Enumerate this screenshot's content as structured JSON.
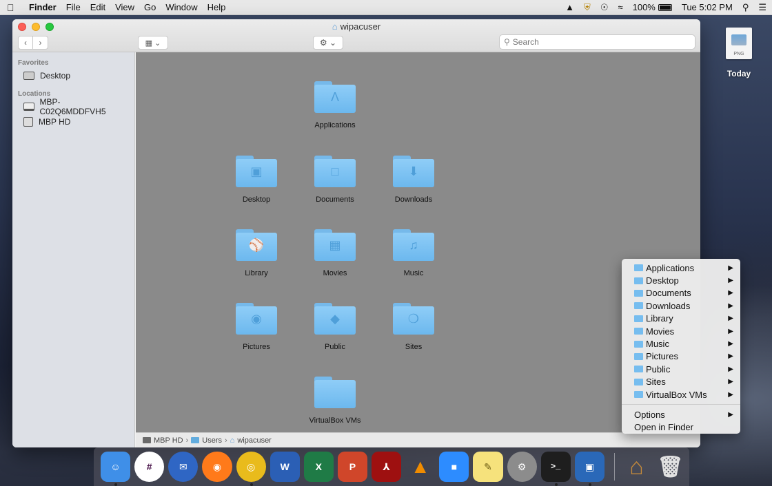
{
  "menubar": {
    "app": "Finder",
    "items": [
      "File",
      "Edit",
      "View",
      "Go",
      "Window",
      "Help"
    ],
    "battery": "100%",
    "clock": "Tue 5:02 PM"
  },
  "window": {
    "title": "wipacuser",
    "search_placeholder": "Search",
    "view_label": "▦",
    "sidebar": {
      "favorites_heading": "Favorites",
      "favorites": [
        {
          "label": "Desktop"
        }
      ],
      "locations_heading": "Locations",
      "locations": [
        {
          "label": "MBP-C02Q6MDDFVH5"
        },
        {
          "label": "MBP HD"
        }
      ]
    },
    "folders": [
      {
        "label": "Applications",
        "icon": "apps-icon"
      },
      {
        "label": "Desktop",
        "icon": "desktop-icon"
      },
      {
        "label": "Documents",
        "icon": "documents-icon"
      },
      {
        "label": "Downloads",
        "icon": "downloads-icon"
      },
      {
        "label": "Library",
        "icon": "library-icon"
      },
      {
        "label": "Movies",
        "icon": "movies-icon"
      },
      {
        "label": "Music",
        "icon": "music-icon"
      },
      {
        "label": "Pictures",
        "icon": "pictures-icon"
      },
      {
        "label": "Public",
        "icon": "public-icon"
      },
      {
        "label": "Sites",
        "icon": "sites-icon"
      },
      {
        "label": "VirtualBox VMs",
        "icon": "folder-icon"
      }
    ],
    "pathbar": [
      "MBP HD",
      "Users",
      "wipacuser"
    ]
  },
  "desktop_item": {
    "label": "Today",
    "ext": "PNG"
  },
  "context_menu": {
    "folders": [
      "Applications",
      "Desktop",
      "Documents",
      "Downloads",
      "Library",
      "Movies",
      "Music",
      "Pictures",
      "Public",
      "Sites",
      "VirtualBox VMs"
    ],
    "options": "Options",
    "open_in_finder": "Open in Finder"
  },
  "dock": [
    {
      "name": "finder",
      "color": "#3f8fe8",
      "glyph": "☺"
    },
    {
      "name": "slack",
      "color": "#ffffff",
      "glyph": "#"
    },
    {
      "name": "thunderbird",
      "color": "#2f66c4",
      "glyph": "✉"
    },
    {
      "name": "firefox",
      "color": "#ff7a1a",
      "glyph": "◉"
    },
    {
      "name": "chrome",
      "color": "#e9bb1c",
      "glyph": "◎"
    },
    {
      "name": "word",
      "color": "#2b5fb5",
      "glyph": "W"
    },
    {
      "name": "excel",
      "color": "#1f7b46",
      "glyph": "X"
    },
    {
      "name": "powerpoint",
      "color": "#d0462a",
      "glyph": "P"
    },
    {
      "name": "acrobat",
      "color": "#9e1010",
      "glyph": "⅄"
    },
    {
      "name": "vlc",
      "color": "#f08c00",
      "glyph": "▲"
    },
    {
      "name": "zoom",
      "color": "#2d8cff",
      "glyph": "■"
    },
    {
      "name": "stickies",
      "color": "#f6e27c",
      "glyph": "✎"
    },
    {
      "name": "system-preferences",
      "color": "#8c8c8c",
      "glyph": "⚙"
    },
    {
      "name": "terminal",
      "color": "#1e1e1e",
      "glyph": ">_"
    },
    {
      "name": "virtualbox",
      "color": "#2a68b8",
      "glyph": "▣"
    }
  ],
  "colors": {
    "folder": "#74bdf0",
    "content_bg": "#8a8a8a",
    "accent": "#5b9bd6"
  }
}
